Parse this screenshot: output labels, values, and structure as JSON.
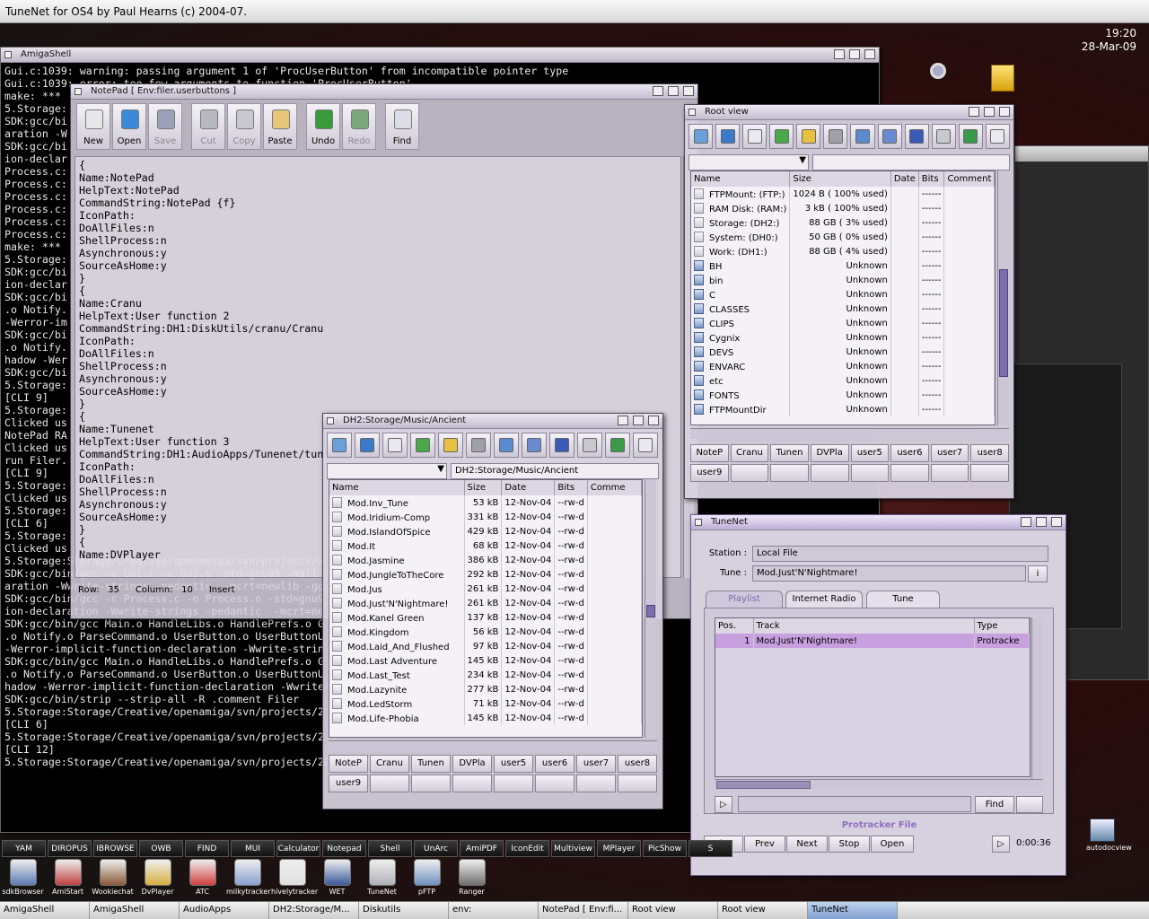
{
  "screen": {
    "title": "TuneNet for OS4 by Paul Hearns (c) 2004-07.",
    "time": "19:20",
    "date": "28-Mar-09"
  },
  "shell": {
    "title": "AmigaShell",
    "lines": [
      "Gui.c:1039: warning: passing argument 1 of 'ProcUserButton' from incompatible pointer type",
      "Gui.c:1039: error: too few arguments to function 'ProcUserButton'",
      "make: ***",
      "5.Storage:",
      "SDK:gcc/bi",
      "aration -W",
      "SDK:gcc/bi",
      "ion-declar",
      "Process.c:",
      "Process.c:",
      "Process.c:",
      "Process.c:",
      "Process.c:",
      "Process.c:",
      "make: ***",
      "5.Storage:",
      "SDK:gcc/bi",
      "ion-declar",
      "SDK:gcc/bi",
      ".o Notify.",
      "-Werror-im",
      "SDK:gcc/bi",
      ".o Notify.",
      "hadow -Wer",
      "SDK:gcc/bi",
      "5.Storage:",
      "[CLI 9]",
      "5.Storage:",
      "Clicked us",
      "NotePad RA",
      "Clicked us",
      "run Filer.",
      "[CLI 9]",
      "5.Storage:",
      "Clicked us",
      "",
      "5.Storage:",
      "[CLI 6]",
      "5.Storage:",
      "Clicked us",
      "",
      "5.Storage:Storage/Creative/openamiga/svn/projects/2",
      "SDK:gcc/bin/gcc -c Gui.c -o Gui.o -std=gnu99 -Wall",
      "aration -Wwrite-strings -pedantic  -mcrt=newlib -gg",
      "SDK:gcc/bin/gcc -c Process.c -o Process.o -std=gnu9",
      "ion-declaration -Wwrite-strings -pedantic  -mcrt=ne",
      "SDK:gcc/bin/gcc Main.o HandleLibs.o HandlePrefs.o G",
      ".o Notify.o ParseCommand.o UserButton.o UserButtonU",
      "-Werror-implicit-function-declaration -Wwrite-strin",
      "SDK:gcc/bin/gcc Main.o HandleLibs.o HandlePrefs.o G",
      ".o Notify.o ParseCommand.o UserButton.o UserButtonU",
      "hadow -Werror-implicit-function-declaration -Wwrite",
      "SDK:gcc/bin/strip --strip-all -R .comment Filer",
      "5.Storage:Storage/Creative/openamiga/svn/projects/2",
      "[CLI 6]",
      "5.Storage:Storage/Creative/openamiga/svn/projects/2",
      "[CLI 12]",
      "5.Storage:Storage/Creative/openamiga/svn/projects/20/src> "
    ]
  },
  "notepad": {
    "title": "NotePad [ Env:filer.userbuttons ]",
    "toolbar": [
      {
        "label": "New",
        "enabled": true,
        "icon": "new-document-icon",
        "color": "#e8e8ec"
      },
      {
        "label": "Open",
        "enabled": true,
        "icon": "open-icon",
        "color": "#3a8ad8"
      },
      {
        "label": "Save",
        "enabled": false,
        "icon": "save-icon",
        "color": "#9aa0b8"
      },
      {
        "label": "Cut",
        "enabled": false,
        "icon": "cut-icon",
        "color": "#b8b8c0"
      },
      {
        "label": "Copy",
        "enabled": false,
        "icon": "copy-icon",
        "color": "#c8c8d0"
      },
      {
        "label": "Paste",
        "enabled": true,
        "icon": "paste-icon",
        "color": "#e8c878"
      },
      {
        "label": "Undo",
        "enabled": true,
        "icon": "undo-icon",
        "color": "#3a9a3a"
      },
      {
        "label": "Redo",
        "enabled": false,
        "icon": "redo-icon",
        "color": "#7aa87a"
      },
      {
        "label": "Find",
        "enabled": true,
        "icon": "find-icon",
        "color": "#dcdce4"
      }
    ],
    "lines": [
      "{",
      "Name:NotePad",
      "HelpText:NotePad",
      "CommandString:NotePad {f}",
      "IconPath:",
      "DoAllFiles:n",
      "ShellProcess:n",
      "Asynchronous:y",
      "SourceAsHome:y",
      "}",
      "{",
      "Name:Cranu",
      "HelpText:User function 2",
      "CommandString:DH1:DiskUtils/cranu/Cranu",
      "IconPath:",
      "DoAllFiles:n",
      "ShellProcess:n",
      "Asynchronous:y",
      "SourceAsHome:y",
      "}",
      "{",
      "Name:Tunenet",
      "HelpText:User function 3",
      "CommandString:DH1:AudioApps/Tunenet/tun",
      "IconPath:",
      "DoAllFiles:n",
      "ShellProcess:n",
      "Asynchronous:y",
      "SourceAsHome:y",
      "}",
      "{",
      "Name:DVPlayer"
    ],
    "status": {
      "row_label": "Row:",
      "row": "35",
      "col_label": "Column:",
      "col": "10",
      "mode": "Insert"
    }
  },
  "rootview": {
    "title": "Root view",
    "columns": [
      "Name",
      "Size",
      "Date",
      "Bits",
      "Comment"
    ],
    "rows": [
      {
        "name": "FTPMount: (FTP:)",
        "size": "1024 B ( 100% used)",
        "date": "",
        "bits": "------",
        "drawer": false
      },
      {
        "name": "RAM Disk: (RAM:)",
        "size": "3 kB ( 100% used)",
        "date": "",
        "bits": "------",
        "drawer": false
      },
      {
        "name": "Storage: (DH2:)",
        "size": "88 GB ( 3% used)",
        "date": "",
        "bits": "------",
        "drawer": false
      },
      {
        "name": "System: (DH0:)",
        "size": "50 GB ( 0% used)",
        "date": "",
        "bits": "------",
        "drawer": false
      },
      {
        "name": "Work: (DH1:)",
        "size": "88 GB ( 4% used)",
        "date": "",
        "bits": "------",
        "drawer": false
      },
      {
        "name": "BH",
        "size": "Unknown",
        "date": "",
        "bits": "------",
        "drawer": true
      },
      {
        "name": "bin",
        "size": "Unknown",
        "date": "",
        "bits": "------",
        "drawer": true
      },
      {
        "name": "C",
        "size": "Unknown",
        "date": "",
        "bits": "------",
        "drawer": true
      },
      {
        "name": "CLASSES",
        "size": "Unknown",
        "date": "",
        "bits": "------",
        "drawer": true
      },
      {
        "name": "CLIPS",
        "size": "Unknown",
        "date": "",
        "bits": "------",
        "drawer": true
      },
      {
        "name": "Cygnix",
        "size": "Unknown",
        "date": "",
        "bits": "------",
        "drawer": true
      },
      {
        "name": "DEVS",
        "size": "Unknown",
        "date": "",
        "bits": "------",
        "drawer": true
      },
      {
        "name": "ENVARC",
        "size": "Unknown",
        "date": "",
        "bits": "------",
        "drawer": true
      },
      {
        "name": "etc",
        "size": "Unknown",
        "date": "",
        "bits": "------",
        "drawer": true
      },
      {
        "name": "FONTS",
        "size": "Unknown",
        "date": "",
        "bits": "------",
        "drawer": true
      },
      {
        "name": "FTPMountDir",
        "size": "Unknown",
        "date": "",
        "bits": "------",
        "drawer": true
      }
    ],
    "user_buttons": [
      "NoteP",
      "Cranu",
      "Tunen",
      "DVPla",
      "user5",
      "user6",
      "user7",
      "user8",
      "user9",
      "",
      "",
      "",
      "",
      "",
      "",
      ""
    ]
  },
  "musicview": {
    "title": "DH2:Storage/Music/Ancient",
    "path": "DH2:Storage/Music/Ancient",
    "columns": [
      "Name",
      "Size",
      "Date",
      "Bits",
      "Comme"
    ],
    "rows": [
      {
        "name": "Mod.Inv_Tune",
        "size": "53 kB",
        "date": "12-Nov-04",
        "bits": "--rw-d"
      },
      {
        "name": "Mod.Iridium-Comp",
        "size": "331 kB",
        "date": "12-Nov-04",
        "bits": "--rw-d"
      },
      {
        "name": "Mod.IslandOfSpice",
        "size": "429 kB",
        "date": "12-Nov-04",
        "bits": "--rw-d"
      },
      {
        "name": "Mod.It",
        "size": "68 kB",
        "date": "12-Nov-04",
        "bits": "--rw-d"
      },
      {
        "name": "Mod.Jasmine",
        "size": "386 kB",
        "date": "12-Nov-04",
        "bits": "--rw-d"
      },
      {
        "name": "Mod.JungleToTheCore",
        "size": "292 kB",
        "date": "12-Nov-04",
        "bits": "--rw-d"
      },
      {
        "name": "Mod.Jus",
        "size": "261 kB",
        "date": "12-Nov-04",
        "bits": "--rw-d"
      },
      {
        "name": "Mod.Just'N'Nightmare!",
        "size": "261 kB",
        "date": "12-Nov-04",
        "bits": "--rw-d"
      },
      {
        "name": "Mod.Kanel Green",
        "size": "137 kB",
        "date": "12-Nov-04",
        "bits": "--rw-d"
      },
      {
        "name": "Mod.Kingdom",
        "size": "56 kB",
        "date": "12-Nov-04",
        "bits": "--rw-d"
      },
      {
        "name": "Mod.Laid_And_Flushed",
        "size": "97 kB",
        "date": "12-Nov-04",
        "bits": "--rw-d"
      },
      {
        "name": "Mod.Last Adventure",
        "size": "145 kB",
        "date": "12-Nov-04",
        "bits": "--rw-d"
      },
      {
        "name": "Mod.Last_Test",
        "size": "234 kB",
        "date": "12-Nov-04",
        "bits": "--rw-d"
      },
      {
        "name": "Mod.Lazynite",
        "size": "277 kB",
        "date": "12-Nov-04",
        "bits": "--rw-d"
      },
      {
        "name": "Mod.LedStorm",
        "size": "71 kB",
        "date": "12-Nov-04",
        "bits": "--rw-d"
      },
      {
        "name": "Mod.Life-Phobia",
        "size": "145 kB",
        "date": "12-Nov-04",
        "bits": "--rw-d"
      }
    ],
    "user_buttons": [
      "NoteP",
      "Cranu",
      "Tunen",
      "DVPla",
      "user5",
      "user6",
      "user7",
      "user8",
      "user9",
      "",
      "",
      "",
      "",
      "",
      "",
      ""
    ]
  },
  "filer_toolbar_icons": [
    {
      "icon": "parent-icon",
      "color": "#6aa0d8"
    },
    {
      "icon": "root-icon",
      "color": "#3a7ac8"
    },
    {
      "icon": "new-drawer-icon",
      "color": "#e8e8ee"
    },
    {
      "icon": "refresh-icon",
      "color": "#4aa84a"
    },
    {
      "icon": "select-icon",
      "color": "#e8c040"
    },
    {
      "icon": "delete-icon",
      "color": "#a0a0a8"
    },
    {
      "icon": "copy-icon",
      "color": "#5a8ad0"
    },
    {
      "icon": "window-icon",
      "color": "#6a8ad0"
    },
    {
      "icon": "info-icon",
      "color": "#3a5ab8"
    },
    {
      "icon": "search-icon",
      "color": "#c8c8d0"
    },
    {
      "icon": "reload-icon",
      "color": "#3a9a4a"
    },
    {
      "icon": "hash-icon",
      "color": "#e8e8ee"
    }
  ],
  "tunenet": {
    "title": "TuneNet",
    "station_label": "Station :",
    "station": "Local File",
    "tune_label": "Tune :",
    "tune": "Mod.Just'N'Nightmare!",
    "info_button": "i",
    "tabs": [
      "Playlist",
      "Internet Radio",
      "Tune"
    ],
    "columns": [
      "Pos.",
      "Track",
      "Type"
    ],
    "playlist": [
      {
        "pos": "1",
        "track": "Mod.Just'N'Nightmare!",
        "type": "Protracke"
      }
    ],
    "find_label": "Find",
    "format": "Protracker File",
    "controls": [
      "Play",
      "Prev",
      "Next",
      "Stop",
      "Open"
    ],
    "time": "0:00:36",
    "accent": "#c8a0e0"
  },
  "dock1": [
    "YAM",
    "DIROPUS",
    "IBROWSE",
    "OWB",
    "FIND",
    "MUI",
    "Calculator",
    "Notepad",
    "Shell",
    "UnArc",
    "AmiPDF",
    "IconEdit",
    "Multiview",
    "MPlayer",
    "PicShow",
    "S"
  ],
  "dock2": [
    {
      "label": "sdkBrowser",
      "color": "#5a7ab0"
    },
    {
      "label": "AmiStart",
      "color": "#c04040"
    },
    {
      "label": "Wookiechat",
      "color": "#8a5a3a"
    },
    {
      "label": "DvPlayer",
      "color": "#d8b040"
    },
    {
      "label": "ATC",
      "color": "#d04040"
    },
    {
      "label": "milkytracker",
      "color": "#8aa0d0"
    },
    {
      "label": "hivelytracker",
      "color": "#e0e0e0"
    },
    {
      "label": "WET",
      "color": "#3a5a9a"
    },
    {
      "label": "TuneNet",
      "color": "#b0b0b8"
    },
    {
      "label": "pFTP",
      "color": "#7090c0"
    },
    {
      "label": "Ranger",
      "color": "#707070"
    }
  ],
  "autodoc_label": "autodocview",
  "taskbar": [
    "AmigaShell",
    "AmigaShell",
    "AudioApps",
    "DH2:Storage/M...",
    "Diskutils",
    "env:",
    "NotePad [ Env:fi...",
    "Root view",
    "Root view",
    "TuneNet"
  ],
  "taskbar_active": "TuneNet"
}
